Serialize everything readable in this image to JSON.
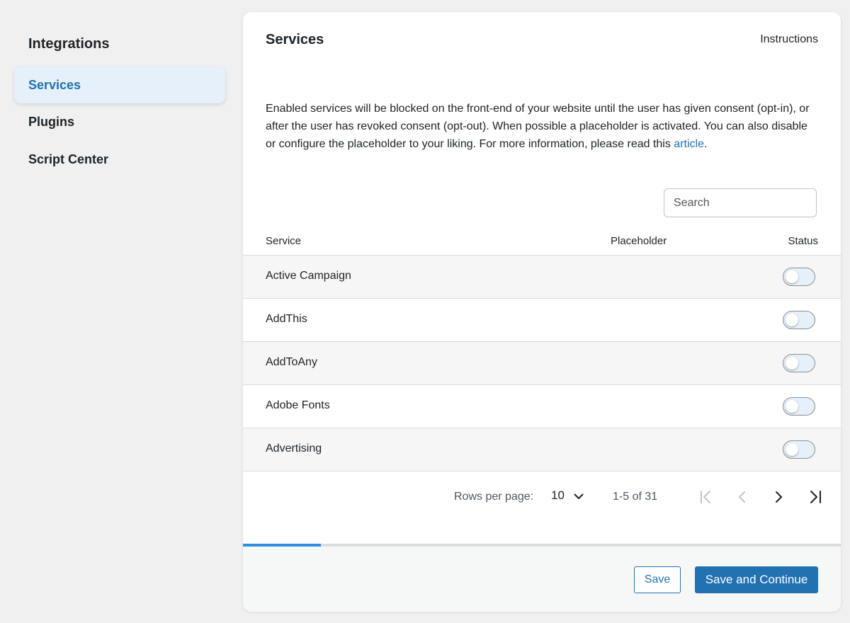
{
  "sidebar": {
    "title": "Integrations",
    "items": [
      {
        "label": "Services",
        "active": true
      },
      {
        "label": "Plugins",
        "active": false
      },
      {
        "label": "Script Center",
        "active": false
      }
    ]
  },
  "card": {
    "title": "Services",
    "instructions_label": "Instructions",
    "description_text": "Enabled services will be blocked on the front-end of your website until the user has given consent (opt-in), or after the user has revoked consent (opt-out). When possible a placeholder is activated. You can also disable or configure the placeholder to your liking. For more information, please read this ",
    "description_link": "article",
    "description_end": "."
  },
  "search": {
    "placeholder": "Search",
    "value": ""
  },
  "table": {
    "columns": {
      "service": "Service",
      "placeholder": "Placeholder",
      "status": "Status"
    },
    "rows": [
      {
        "service": "Active Campaign",
        "enabled": false
      },
      {
        "service": "AddThis",
        "enabled": false
      },
      {
        "service": "AddToAny",
        "enabled": false
      },
      {
        "service": "Adobe Fonts",
        "enabled": false
      },
      {
        "service": "Advertising",
        "enabled": false
      }
    ]
  },
  "pagination": {
    "rows_per_page_label": "Rows per page:",
    "rows_per_page_value": "10",
    "range_text": "1-5 of 31"
  },
  "progress": {
    "percent": 13
  },
  "footer": {
    "save_label": "Save",
    "save_continue_label": "Save and Continue"
  },
  "colors": {
    "accent": "#2271b1",
    "progress": "#2d8fe0",
    "active_menu_bg": "#e5f0fa"
  },
  "icons": [
    "chevron-down-icon",
    "first-page-icon",
    "prev-page-icon",
    "next-page-icon",
    "last-page-icon"
  ]
}
